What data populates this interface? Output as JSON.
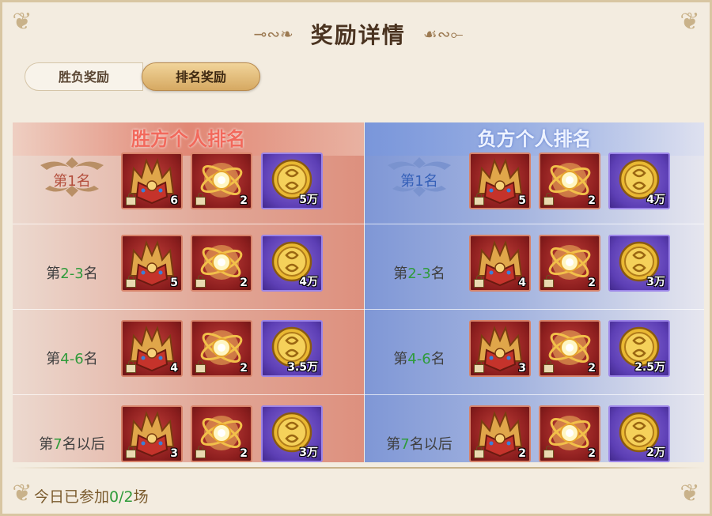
{
  "title": "奖励详情",
  "tabs": [
    {
      "label": "胜负奖励",
      "active": false
    },
    {
      "label": "排名奖励",
      "active": true
    }
  ],
  "columns": {
    "winner_header": "胜方个人排名",
    "loser_header": "负方个人排名"
  },
  "rows": [
    {
      "pre": "第",
      "rank": "1",
      "post": "名",
      "winner": [
        "6",
        "2",
        "5万"
      ],
      "loser": [
        "5",
        "2",
        "4万"
      ]
    },
    {
      "pre": "第",
      "rank": "2-3",
      "post": "名",
      "winner": [
        "5",
        "2",
        "4万"
      ],
      "loser": [
        "4",
        "2",
        "3万"
      ]
    },
    {
      "pre": "第",
      "rank": "4-6",
      "post": "名",
      "winner": [
        "4",
        "2",
        "3.5万"
      ],
      "loser": [
        "3",
        "2",
        "2.5万"
      ]
    },
    {
      "pre": "第",
      "rank": "7",
      "post": "名以后",
      "winner": [
        "3",
        "2",
        "3万"
      ],
      "loser": [
        "2",
        "2",
        "2万"
      ]
    }
  ],
  "items": [
    "helmet-armor-icon",
    "golden-orb-icon",
    "gold-coin-icon"
  ],
  "footer": {
    "prefix": "今日已参加",
    "count": "0/2",
    "suffix": "场"
  },
  "colors": {
    "win": "#f2695c",
    "lose": "#eef3ff",
    "highlight": "#2e9b3a"
  }
}
